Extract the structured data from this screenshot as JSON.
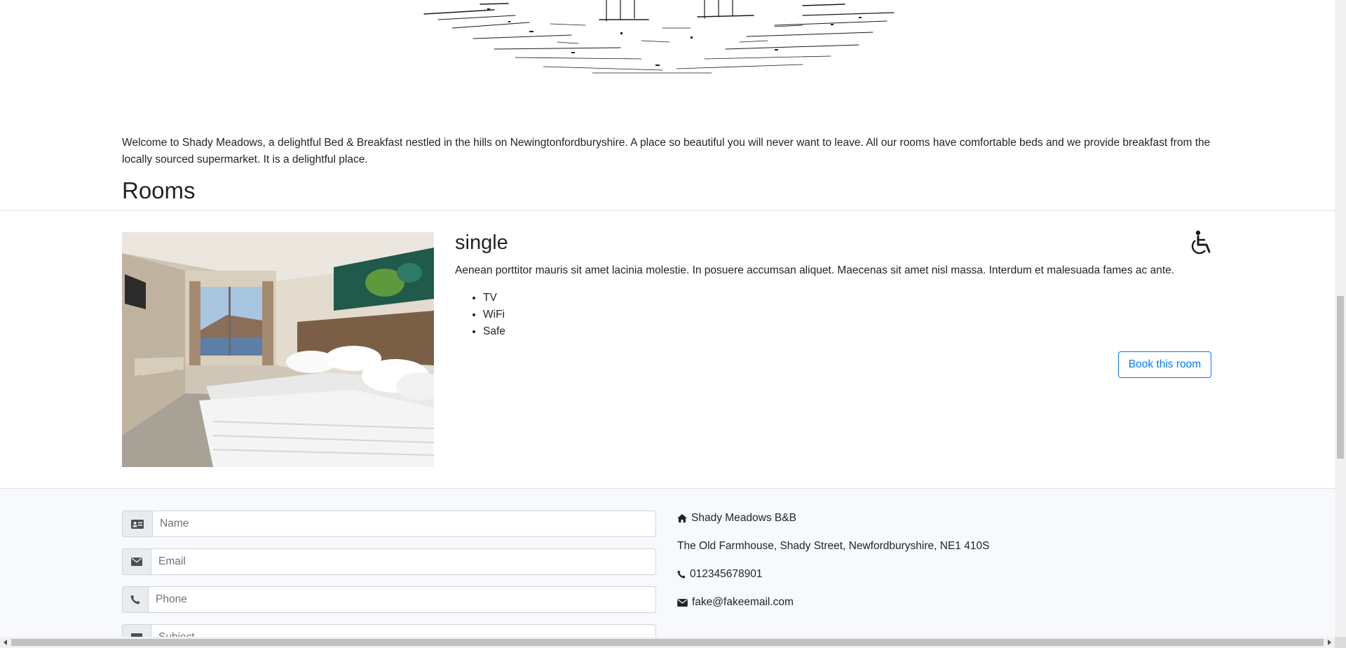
{
  "intro": {
    "welcome_text": "Welcome to Shady Meadows, a delightful Bed & Breakfast nestled in the hills on Newingtonfordburyshire. A place so beautiful you will never want to leave. All our rooms have comfortable beds and we provide breakfast from the locally sourced supermarket. It is a delightful place."
  },
  "rooms": {
    "heading": "Rooms",
    "items": [
      {
        "type": "single",
        "description": "Aenean porttitor mauris sit amet lacinia molestie. In posuere accumsan aliquet. Maecenas sit amet nisl massa. Interdum et malesuada fames ac ante.",
        "features": [
          "TV",
          "WiFi",
          "Safe"
        ],
        "accessible_icon": "wheelchair-icon",
        "book_label": "Book this room"
      }
    ]
  },
  "contact_form": {
    "name_placeholder": "Name",
    "email_placeholder": "Email",
    "phone_placeholder": "Phone",
    "subject_placeholder": "Subject"
  },
  "contact_details": {
    "name": "Shady Meadows B&B",
    "address": "The Old Farmhouse, Shady Street, Newfordburyshire, NE1 410S",
    "phone": "012345678901",
    "email": "fake@fakeemail.com"
  },
  "colors": {
    "accent": "#007bff",
    "contact_background": "#f7f9fc",
    "addon_background": "#e9ecef"
  }
}
